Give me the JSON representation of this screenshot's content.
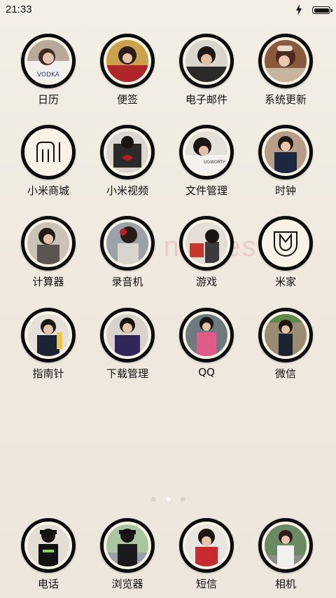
{
  "status_bar": {
    "time": "21:33"
  },
  "watermark": "Tab ne ries",
  "grid": [
    {
      "label": "日历",
      "icon": "photo-girl-icon"
    },
    {
      "label": "便签",
      "icon": "photo-girl-icon"
    },
    {
      "label": "电子邮件",
      "icon": "photo-girl-icon"
    },
    {
      "label": "系统更新",
      "icon": "photo-girl-icon"
    },
    {
      "label": "小米商城",
      "icon": "mi-logo-icon"
    },
    {
      "label": "小米视频",
      "icon": "photo-girl-icon"
    },
    {
      "label": "文件管理",
      "icon": "photo-girl-icon"
    },
    {
      "label": "时钟",
      "icon": "photo-girl-icon"
    },
    {
      "label": "计算器",
      "icon": "photo-girl-icon"
    },
    {
      "label": "录音机",
      "icon": "photo-girl-icon"
    },
    {
      "label": "游戏",
      "icon": "photo-girl-icon"
    },
    {
      "label": "米家",
      "icon": "mijia-logo-icon"
    },
    {
      "label": "指南针",
      "icon": "photo-girl-icon"
    },
    {
      "label": "下载管理",
      "icon": "photo-girl-icon"
    },
    {
      "label": "QQ",
      "icon": "photo-girl-icon"
    },
    {
      "label": "微信",
      "icon": "photo-girl-icon"
    }
  ],
  "page_indicator": {
    "count": 3,
    "active": 2
  },
  "dock": [
    {
      "label": "电话",
      "icon": "photo-girl-icon"
    },
    {
      "label": "浏览器",
      "icon": "photo-girl-icon"
    },
    {
      "label": "短信",
      "icon": "photo-girl-icon"
    },
    {
      "label": "相机",
      "icon": "photo-girl-icon"
    }
  ],
  "colors": {
    "background": "#efe9df",
    "ring": "#0c0c0c",
    "label": "#111111"
  }
}
